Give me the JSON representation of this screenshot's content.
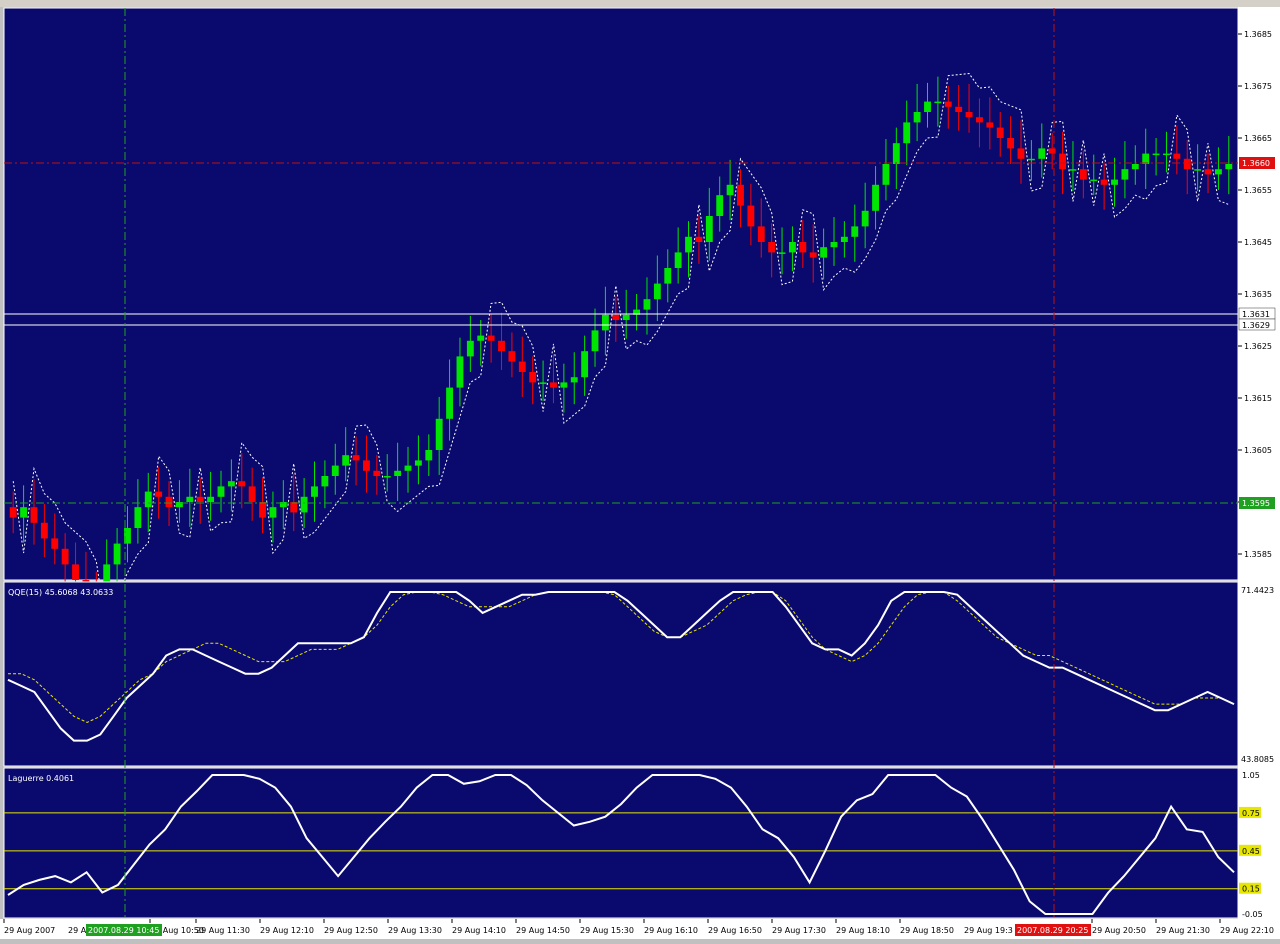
{
  "colors": {
    "background": "#0a0a6e",
    "bull": "#00e600",
    "bear": "#ff0000",
    "line": "#ffffff",
    "level": "#e6e600",
    "bid_marker": "#e01010",
    "ask_marker": "#20a020",
    "crosshair_green": "#1fa01f",
    "crosshair_red": "#c01010"
  },
  "price_panel": {
    "ticks": [
      "1.3685",
      "1.3675",
      "1.3665",
      "1.3655",
      "1.3645",
      "1.3635",
      "1.3625",
      "1.3615",
      "1.3605",
      "1.3595",
      "1.3585"
    ],
    "bid_marker": "1.3660",
    "ask_marker": "1.3595",
    "hline_upper": "1.3631",
    "hline_lower": "1.3629"
  },
  "qqe_panel": {
    "title": "QQE(15) 45.6068 43.0633",
    "y_max": "71.4423",
    "y_min": "43.8085"
  },
  "laguerre_panel": {
    "title": "Laguerre 0.4061",
    "ticks": [
      "1.05",
      "0.75",
      "0.45",
      "0.15",
      "-0.05"
    ]
  },
  "time_axis": {
    "labels": [
      "29 Aug 2007",
      "29 Aug 10:50",
      "29 Aug 11:30",
      "29 Aug 12:10",
      "29 Aug 12:50",
      "29 Aug 13:30",
      "29 Aug 14:10",
      "29 Aug 14:50",
      "29 Aug 15:30",
      "29 Aug 16:10",
      "29 Aug 16:50",
      "29 Aug 17:30",
      "29 Aug 18:10",
      "29 Aug 18:50",
      "29 Aug 20:50",
      "29 Aug 21:30",
      "29 Aug 22:10"
    ],
    "partial_label": "29 A",
    "cursor_label_left": "2007.08.29 10:45",
    "cursor_label_right": "2007.08.29 20:25",
    "partial_label_right": "29 Aug 19:3"
  },
  "chart_data": {
    "type": "candlestick",
    "symbol_quote_precision": 4,
    "candles_close": [
      1.3592,
      1.3594,
      1.3591,
      1.3588,
      1.3586,
      1.3583,
      1.358,
      1.3578,
      1.3577,
      1.3583,
      1.3587,
      1.359,
      1.3594,
      1.3597,
      1.3596,
      1.3594,
      1.3595,
      1.3596,
      1.3595,
      1.3596,
      1.3598,
      1.3599,
      1.3598,
      1.3595,
      1.3592,
      1.3594,
      1.3595,
      1.3593,
      1.3596,
      1.3598,
      1.36,
      1.3602,
      1.3604,
      1.3603,
      1.3601,
      1.36,
      1.36,
      1.3601,
      1.3602,
      1.3603,
      1.3605,
      1.3611,
      1.3617,
      1.3623,
      1.3626,
      1.3627,
      1.3626,
      1.3624,
      1.3622,
      1.362,
      1.3618,
      1.3618,
      1.3617,
      1.3618,
      1.3619,
      1.3624,
      1.3628,
      1.3631,
      1.363,
      1.3631,
      1.3632,
      1.3634,
      1.3637,
      1.364,
      1.3643,
      1.3646,
      1.3645,
      1.365,
      1.3654,
      1.3656,
      1.3652,
      1.3648,
      1.3645,
      1.3643,
      1.3643,
      1.3645,
      1.3643,
      1.3642,
      1.3644,
      1.3645,
      1.3646,
      1.3648,
      1.3651,
      1.3656,
      1.366,
      1.3664,
      1.3668,
      1.367,
      1.3672,
      1.3672,
      1.3671,
      1.367,
      1.3669,
      1.3668,
      1.3667,
      1.3665,
      1.3663,
      1.3661,
      1.3661,
      1.3663,
      1.3662,
      1.3659,
      1.3659,
      1.3657,
      1.3657,
      1.3656,
      1.3657,
      1.3659,
      1.366,
      1.3662,
      1.3662,
      1.3662,
      1.3661,
      1.3659,
      1.3659,
      1.3658,
      1.3659,
      1.366
    ],
    "qqe_fast": [
      57,
      56,
      55,
      52,
      49,
      47,
      47,
      48,
      51,
      54,
      56,
      58,
      61,
      62,
      62,
      61,
      60,
      59,
      58,
      58,
      59,
      61,
      63,
      63,
      63,
      63,
      63,
      64,
      68,
      72,
      75,
      75,
      74,
      73,
      72,
      70,
      68,
      69,
      70,
      71,
      71,
      72,
      73,
      74,
      75,
      74,
      72,
      70,
      68,
      66,
      64,
      64,
      66,
      68,
      70,
      72,
      74,
      74,
      72,
      69,
      66,
      63,
      62,
      62,
      61,
      63,
      66,
      70,
      72,
      74,
      74,
      73,
      71,
      69,
      67,
      65,
      63,
      61,
      60,
      59,
      59,
      58,
      57,
      56,
      55,
      54,
      53,
      52,
      52,
      53,
      54,
      55,
      54,
      53
    ],
    "qqe_slow": [
      58,
      58,
      57,
      55,
      53,
      51,
      50,
      51,
      53,
      55,
      57,
      58,
      60,
      61,
      62,
      63,
      63,
      62,
      61,
      60,
      60,
      60,
      61,
      62,
      62,
      62,
      63,
      64,
      66,
      69,
      71,
      72,
      72,
      71,
      70,
      69,
      69,
      69,
      69,
      70,
      71,
      72,
      72,
      73,
      73,
      73,
      71,
      69,
      67,
      65,
      64,
      64,
      65,
      66,
      68,
      70,
      71,
      72,
      72,
      70,
      67,
      64,
      62,
      61,
      60,
      61,
      63,
      66,
      69,
      71,
      72,
      72,
      70,
      68,
      66,
      64,
      63,
      62,
      61,
      61,
      60,
      59,
      58,
      57,
      56,
      55,
      54,
      53,
      53,
      53,
      54,
      54,
      54,
      53
    ],
    "laguerre": [
      0.1,
      0.18,
      0.22,
      0.25,
      0.2,
      0.28,
      0.12,
      0.18,
      0.34,
      0.5,
      0.62,
      0.8,
      0.92,
      1.05,
      1.05,
      1.05,
      1.02,
      0.95,
      0.8,
      0.55,
      0.4,
      0.25,
      0.4,
      0.55,
      0.68,
      0.8,
      0.95,
      1.05,
      1.05,
      0.98,
      1.0,
      1.05,
      1.05,
      0.97,
      0.85,
      0.75,
      0.65,
      0.68,
      0.72,
      0.82,
      0.95,
      1.05,
      1.05,
      1.05,
      1.05,
      1.02,
      0.95,
      0.8,
      0.62,
      0.55,
      0.4,
      0.2,
      0.45,
      0.72,
      0.85,
      0.9,
      1.05,
      1.05,
      1.05,
      1.05,
      0.95,
      0.88,
      0.7,
      0.5,
      0.3,
      0.05,
      -0.05,
      -0.05,
      -0.05,
      -0.05,
      0.12,
      0.25,
      0.4,
      0.55,
      0.8,
      0.62,
      0.6,
      0.4,
      0.28
    ],
    "laguerre_levels": [
      0.75,
      0.45,
      0.15
    ],
    "price_ylim": [
      1.358,
      1.369
    ]
  }
}
